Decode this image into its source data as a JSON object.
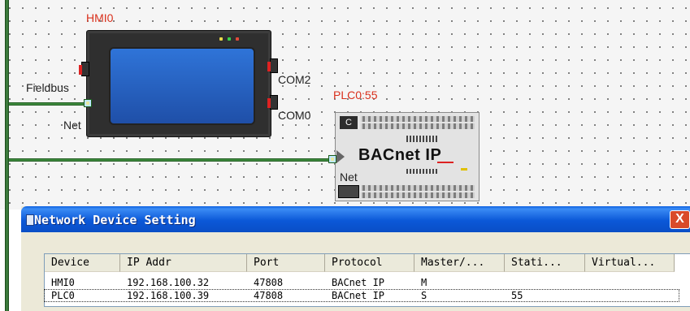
{
  "canvas": {
    "hmi": {
      "name": "HMI0",
      "port_fieldbus": "Fieldbus",
      "port_com2": "COM2",
      "port_com0": "COM0",
      "port_net": "Net"
    },
    "plc": {
      "name": "PLC0:55",
      "model": "BACnet IP",
      "badge": "C",
      "port_net": "Net"
    }
  },
  "dialog": {
    "title": "Network Device Setting",
    "close_label": "X",
    "columns": [
      "Device",
      "IP Addr",
      "Port",
      "Protocol",
      "Master/...",
      "Stati...",
      "Virtual..."
    ],
    "rows": [
      {
        "device": "HMI0",
        "ip": "192.168.100.32",
        "port": "47808",
        "protocol": "BACnet IP",
        "master": "M",
        "station": "",
        "virtual": ""
      },
      {
        "device": "PLC0",
        "ip": "192.168.100.39",
        "port": "47808",
        "protocol": "BACnet IP",
        "master": "S",
        "station": "55",
        "virtual": ""
      }
    ]
  }
}
